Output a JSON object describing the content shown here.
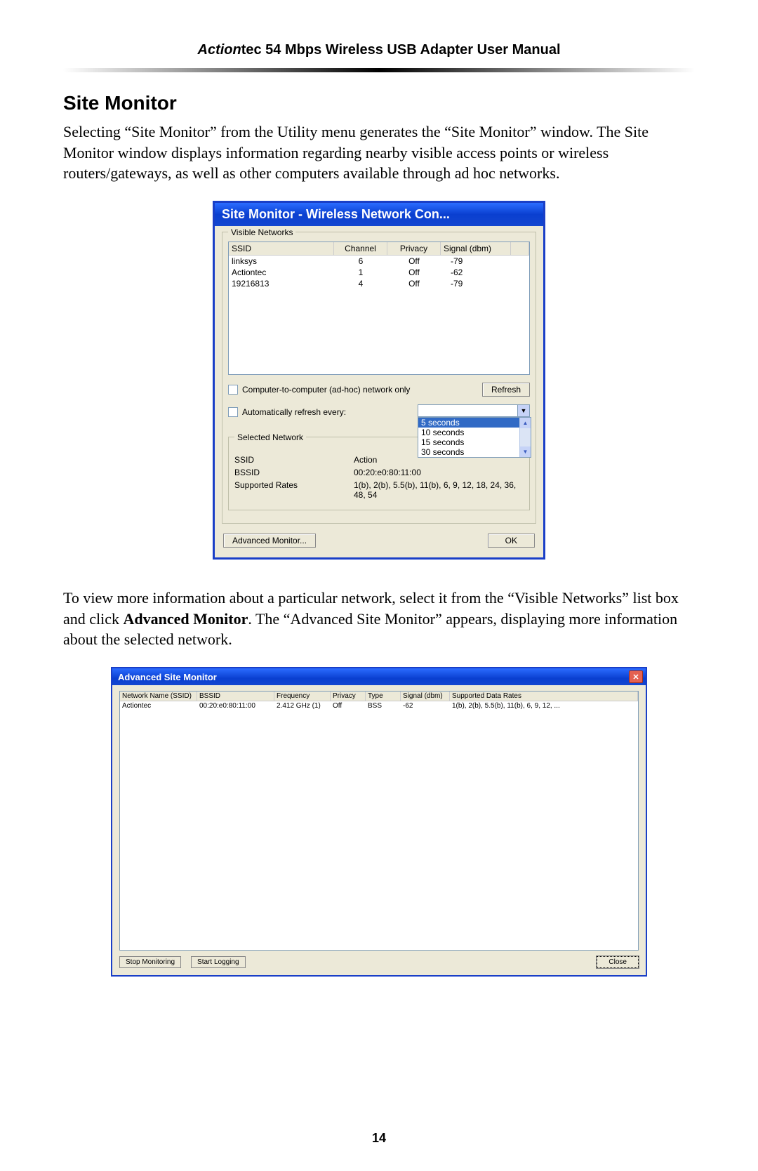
{
  "header": {
    "brand_italic": "Action",
    "brand_rest": "tec 54 Mbps Wireless USB Adapter User Manual"
  },
  "section_title": "Site Monitor",
  "para1": "Selecting “Site Monitor” from the Utility menu generates the “Site Monitor” window. The Site Monitor window displays information regarding nearby visible access points or wireless routers/gateways, as well as other computers available through ad hoc networks.",
  "para2_a": "To view more information about a particular network, select it from the “Visible Networks” list box and click ",
  "para2_bold": "Advanced Monitor",
  "para2_b": ". The “Advanced Site Monitor” appears, displaying more information about the selected network.",
  "page_number": "14",
  "win1": {
    "title": "Site Monitor - Wireless Network Con...",
    "visible_networks_legend": "Visible Networks",
    "columns": {
      "ssid": "SSID",
      "channel": "Channel",
      "privacy": "Privacy",
      "signal": "Signal (dbm)"
    },
    "rows": [
      {
        "ssid": "linksys",
        "channel": "6",
        "privacy": "Off",
        "signal": "-79"
      },
      {
        "ssid": "Actiontec",
        "channel": "1",
        "privacy": "Off",
        "signal": "-62"
      },
      {
        "ssid": "19216813",
        "channel": "4",
        "privacy": "Off",
        "signal": "-79"
      }
    ],
    "adhoc_label": "Computer-to-computer (ad-hoc) network only",
    "refresh_label": "Refresh",
    "autorefresh_label": "Automatically refresh every:",
    "dropdown_options": [
      "5 seconds",
      "10 seconds",
      "15 seconds",
      "30 seconds"
    ],
    "selected_legend": "Selected Network",
    "sel_ssid_k": "SSID",
    "sel_ssid_v": "Action",
    "sel_bssid_k": "BSSID",
    "sel_bssid_v": "00:20:e0:80:11:00",
    "sel_rates_k": "Supported Rates",
    "sel_rates_v": "1(b), 2(b), 5.5(b), 11(b), 6, 9, 12, 18, 24, 36, 48, 54",
    "advanced_btn": "Advanced Monitor...",
    "ok_btn": "OK"
  },
  "win2": {
    "title": "Advanced Site Monitor",
    "columns": {
      "ssid": "Network Name (SSID)",
      "bssid": "BSSID",
      "freq": "Frequency",
      "privacy": "Privacy",
      "type": "Type",
      "signal": "Signal (dbm)",
      "rates": "Supported Data Rates"
    },
    "row": {
      "ssid": "Actiontec",
      "bssid": "00:20:e0:80:11:00",
      "freq": "2.412 GHz (1)",
      "privacy": "Off",
      "type": "BSS",
      "signal": "-62",
      "rates": "1(b), 2(b), 5.5(b), 11(b), 6, 9, 12, ..."
    },
    "stop_btn": "Stop Monitoring",
    "start_btn": "Start Logging",
    "close_btn": "Close"
  }
}
